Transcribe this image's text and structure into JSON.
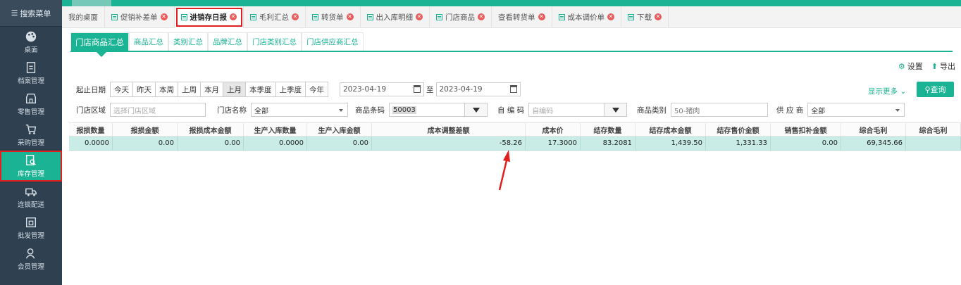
{
  "sidebar": {
    "search_label": "搜索菜单",
    "items": [
      {
        "label": "桌面",
        "icon": "palette-icon"
      },
      {
        "label": "档案管理",
        "icon": "file-icon"
      },
      {
        "label": "零售管理",
        "icon": "store-icon"
      },
      {
        "label": "采购管理",
        "icon": "cart-icon"
      },
      {
        "label": "库存管理",
        "icon": "inventory-search-icon"
      },
      {
        "label": "连锁配送",
        "icon": "truck-icon"
      },
      {
        "label": "批发管理",
        "icon": "wholesale-icon"
      },
      {
        "label": "会员管理",
        "icon": "member-icon"
      }
    ]
  },
  "tabs": [
    {
      "label": "我的桌面",
      "closable": false
    },
    {
      "label": "促销补差单",
      "closable": true
    },
    {
      "label": "进销存日报",
      "closable": true,
      "active": true
    },
    {
      "label": "毛利汇总",
      "closable": true
    },
    {
      "label": "转货单",
      "closable": true
    },
    {
      "label": "出入库明细",
      "closable": true
    },
    {
      "label": "门店商品",
      "closable": true
    },
    {
      "label": "查看转货单",
      "closable": true
    },
    {
      "label": "成本调价单",
      "closable": true
    },
    {
      "label": "下载",
      "closable": true
    }
  ],
  "subtabs": [
    "门店商品汇总",
    "商品汇总",
    "类别汇总",
    "品牌汇总",
    "门店类别汇总",
    "门店供应商汇总"
  ],
  "actions": {
    "settings": "设置",
    "export": "导出"
  },
  "filters": {
    "date_label": "起止日期",
    "periods": [
      "今天",
      "昨天",
      "本周",
      "上周",
      "本月",
      "上月",
      "本季度",
      "上季度",
      "今年"
    ],
    "date_from": "2023-04-19",
    "to_label": "至",
    "date_to": "2023-04-19",
    "show_more": "显示更多",
    "query": "查询",
    "store_area_label": "门店区域",
    "store_area_placeholder": "选择门店区域",
    "store_name_label": "门店名称",
    "store_name_value": "全部",
    "barcode_label": "商品条码",
    "barcode_value": "50003",
    "selfcode_label": "自 编 码",
    "selfcode_placeholder": "自编码",
    "category_label": "商品类别",
    "category_value": "50-猪肉",
    "supplier_label": "供 应 商",
    "supplier_value": "全部"
  },
  "table": {
    "headers": [
      "报损数量",
      "报损金额",
      "报损成本金额",
      "生产入库数量",
      "生产入库金额",
      "成本调整差额",
      "成本价",
      "结存数量",
      "结存成本金额",
      "结存售价金额",
      "销售扣补金额",
      "综合毛利",
      "综合毛利"
    ],
    "row": [
      "0.0000",
      "0.00",
      "0.00",
      "0.0000",
      "0.00",
      "-58.26",
      "17.3000",
      "83.2081",
      "1,439.50",
      "1,331.33",
      "0.00",
      "69,345.66",
      ""
    ]
  }
}
